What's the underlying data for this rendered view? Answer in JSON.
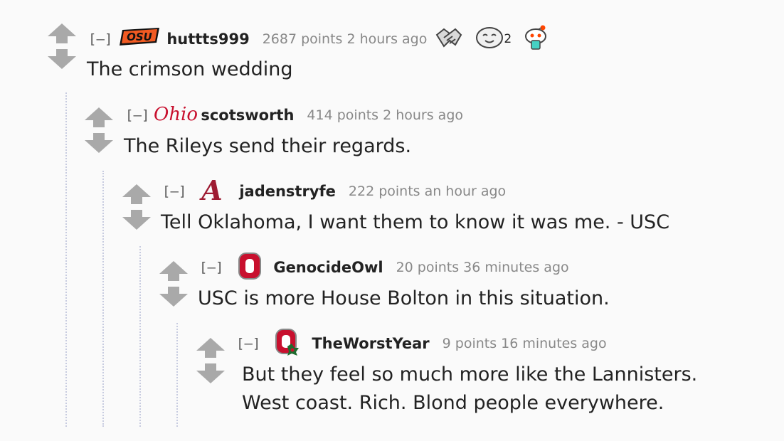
{
  "collapse_label": "[–]",
  "comments": [
    {
      "author": "huttts999",
      "score": "2687 points",
      "time": "2 hours ago",
      "flair": "osu-cowboys-logo",
      "body": [
        "The crimson wedding"
      ],
      "awards": [
        {
          "icon": "handshake-award-icon",
          "count": ""
        },
        {
          "icon": "wholesome-face-award-icon",
          "count": "2"
        },
        {
          "icon": "snoo-drink-award-icon",
          "count": ""
        }
      ]
    },
    {
      "author": "scotsworth",
      "score": "414 points",
      "time": "2 hours ago",
      "flair": "ohio-script-logo",
      "flair_text": "Ohio",
      "body": [
        "The Rileys send their regards."
      ]
    },
    {
      "author": "jadenstryfe",
      "score": "222 points",
      "time": "an hour ago",
      "flair": "alabama-a-logo",
      "flair_text": "A",
      "body": [
        "Tell Oklahoma, I want them to know it was me. - USC"
      ]
    },
    {
      "author": "GenocideOwl",
      "score": "20 points",
      "time": "36 minutes ago",
      "flair": "ohio-state-block-o-logo",
      "body": [
        "USC is more House Bolton in this situation."
      ]
    },
    {
      "author": "TheWorstYear",
      "score": "9 points",
      "time": "16 minutes ago",
      "flair": "ohio-state-holiday-o-logo",
      "body": [
        "But they feel so much more like the Lannisters.",
        "West coast. Rich. Blond people everywhere."
      ]
    }
  ],
  "colors": {
    "background": "#fafafa",
    "arrow": "#a9a9a9",
    "author": "#222222",
    "meta": "#888888",
    "osu_orange": "#f15a22",
    "ohio_red": "#c8102e",
    "alabama_crimson": "#9e1b32",
    "thread_line": "#c8cce0"
  }
}
